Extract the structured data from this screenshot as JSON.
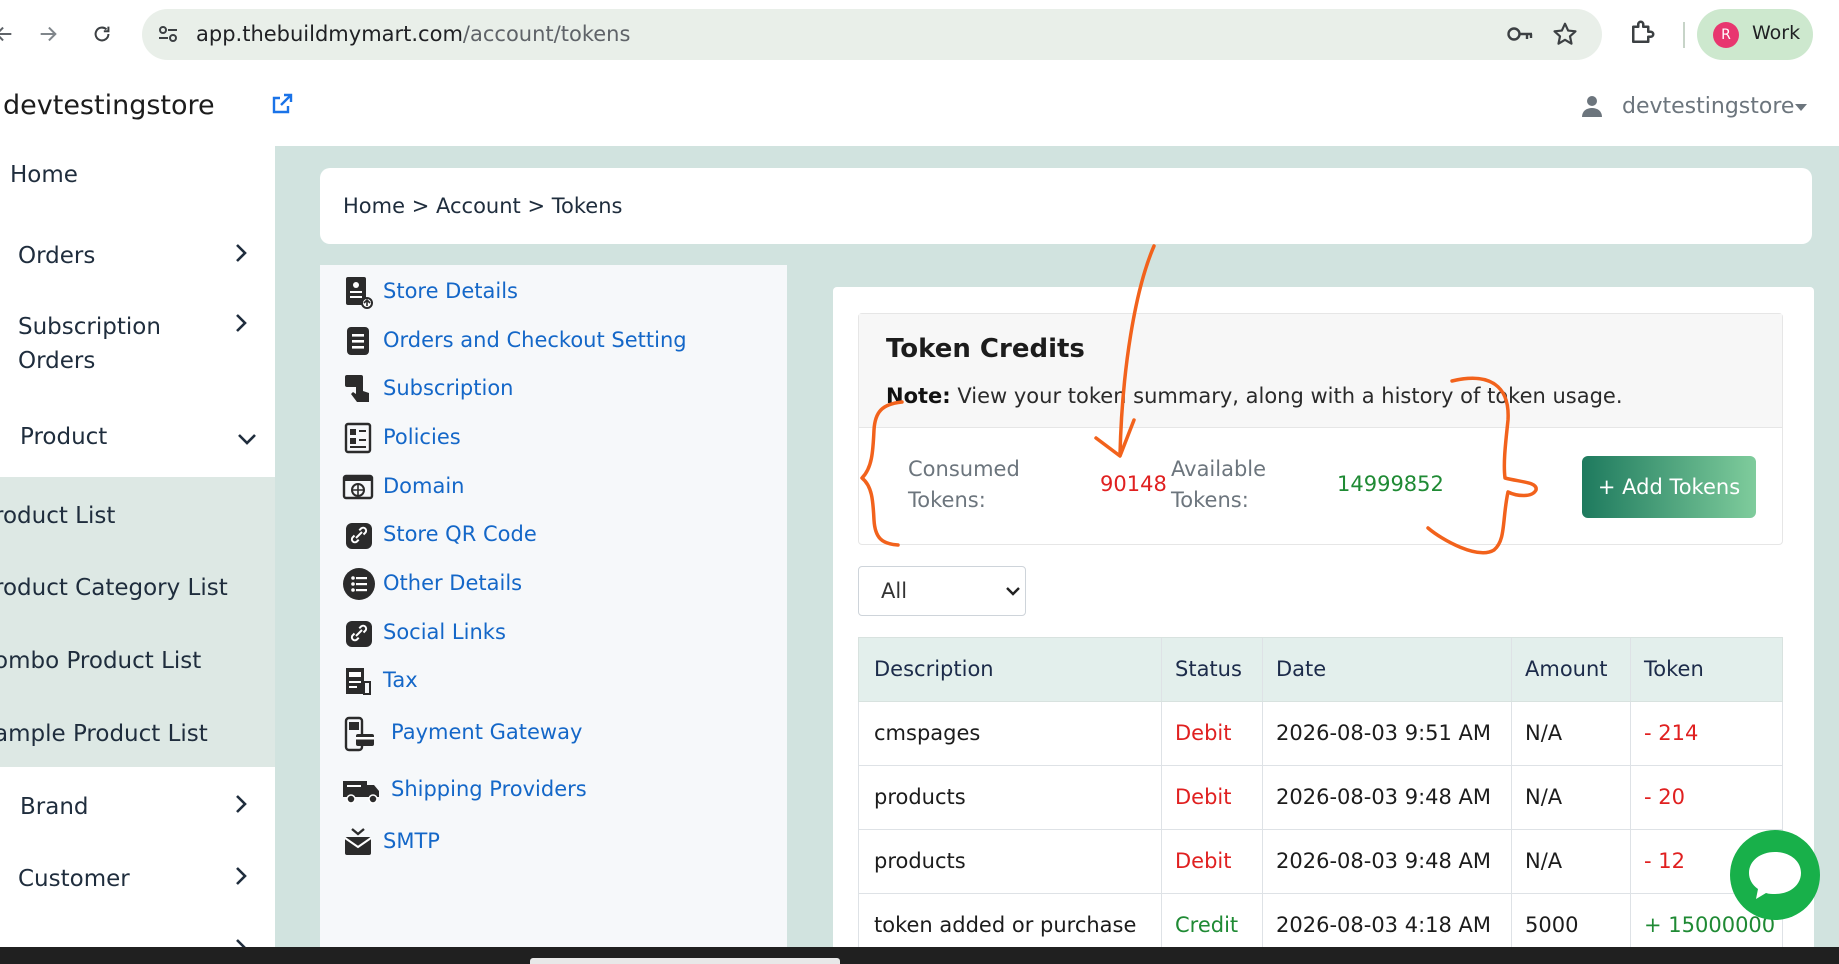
{
  "browser": {
    "url_host": "app.thebuildmymart.com",
    "url_path": "/account/tokens",
    "profile_initial": "R",
    "profile_label": "Work"
  },
  "header": {
    "store_name": "devtestingstore",
    "user_name": "devtestingstore"
  },
  "sidebar": {
    "home": "Home",
    "orders": "Orders",
    "subscription_orders_1": "Subscription",
    "subscription_orders_2": "Orders",
    "product": "Product",
    "product_sub": [
      "roduct List",
      "roduct Category List",
      "ombo Product List",
      "ample Product List"
    ],
    "brand": "Brand",
    "customer": "Customer"
  },
  "breadcrumb": {
    "home": "Home",
    "sep": ">",
    "account": "Account",
    "tokens": "Tokens"
  },
  "settings_menu": [
    {
      "label": "Store Details",
      "icon": "store-details-icon"
    },
    {
      "label": "Orders and Checkout Setting",
      "icon": "document-lines-icon"
    },
    {
      "label": "Subscription",
      "icon": "subscription-hand-icon"
    },
    {
      "label": "Policies",
      "icon": "policies-icon"
    },
    {
      "label": "Domain",
      "icon": "domain-icon"
    },
    {
      "label": "Store QR Code",
      "icon": "link-icon"
    },
    {
      "label": "Other Details",
      "icon": "list-icon"
    },
    {
      "label": "Social Links",
      "icon": "link-icon"
    },
    {
      "label": "Tax",
      "icon": "tax-icon"
    },
    {
      "label": "Payment Gateway",
      "icon": "payment-terminal-icon"
    },
    {
      "label": "Shipping Providers",
      "icon": "truck-icon"
    },
    {
      "label": "SMTP",
      "icon": "mail-icon"
    }
  ],
  "tokens": {
    "title": "Token Credits",
    "note_label": "Note:",
    "note_text": "View your token summary, along with a history of token usage.",
    "consumed_label_1": "Consumed",
    "consumed_label_2": "Tokens:",
    "consumed_value": "90148",
    "available_label_1": "Available",
    "available_label_2": "Tokens:",
    "available_value": "14999852",
    "add_button": "+ Add Tokens",
    "filter_value": "All"
  },
  "table": {
    "headers": [
      "Description",
      "Status",
      "Date",
      "Amount",
      "Token"
    ],
    "rows": [
      {
        "description": "cmspages",
        "status": "Debit",
        "date": "2026-08-03 9:51 AM",
        "amount": "N/A",
        "token": "- 214"
      },
      {
        "description": "products",
        "status": "Debit",
        "date": "2026-08-03 9:48 AM",
        "amount": "N/A",
        "token": "- 20"
      },
      {
        "description": "products",
        "status": "Debit",
        "date": "2026-08-03 9:48 AM",
        "amount": "N/A",
        "token": "- 12"
      },
      {
        "description": "token added or purchase",
        "status": "Credit",
        "date": "2026-08-03 4:18 AM",
        "amount": "5000",
        "token": "+ 15000000"
      }
    ]
  },
  "colors": {
    "debit": "#e02020",
    "credit": "#1f8a34",
    "link": "#1467c8",
    "annotation": "#f2621c"
  }
}
